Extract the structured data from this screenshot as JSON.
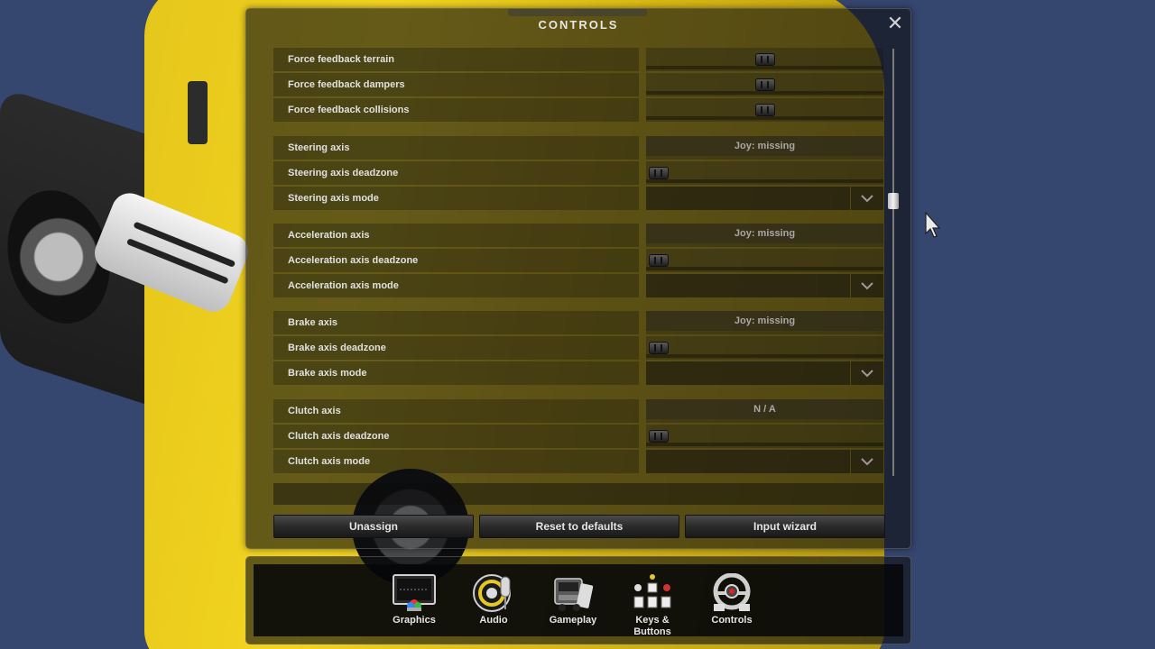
{
  "window": {
    "title": "CONTROLS",
    "close_symbol": "✕"
  },
  "rows": [
    {
      "label": "Force feedback terrain",
      "type": "slider",
      "level": 0.5
    },
    {
      "label": "Force feedback dampers",
      "type": "slider",
      "level": 0.5
    },
    {
      "label": "Force feedback collisions",
      "type": "slider",
      "level": 0.5
    },
    {
      "label": "Steering axis",
      "type": "binding",
      "value": "Joy: missing"
    },
    {
      "label": "Steering axis deadzone",
      "type": "slider",
      "level": 0.0
    },
    {
      "label": "Steering axis mode",
      "type": "dropdown",
      "value": ""
    },
    {
      "label": "Acceleration axis",
      "type": "binding",
      "value": "Joy: missing"
    },
    {
      "label": "Acceleration axis deadzone",
      "type": "slider",
      "level": 0.0
    },
    {
      "label": "Acceleration axis mode",
      "type": "dropdown",
      "value": ""
    },
    {
      "label": "Brake axis",
      "type": "binding",
      "value": "Joy: missing"
    },
    {
      "label": "Brake axis deadzone",
      "type": "slider",
      "level": 0.0
    },
    {
      "label": "Brake axis mode",
      "type": "dropdown",
      "value": ""
    },
    {
      "label": "Clutch axis",
      "type": "binding",
      "value": "N / A"
    },
    {
      "label": "Clutch axis deadzone",
      "type": "slider",
      "level": 0.0
    },
    {
      "label": "Clutch axis mode",
      "type": "dropdown",
      "value": ""
    }
  ],
  "scroll_position": 0.35,
  "buttons": {
    "unassign": "Unassign",
    "reset": "Reset to defaults",
    "wizard": "Input wizard"
  },
  "nav": [
    {
      "label": "Graphics",
      "icon": "monitor-icon"
    },
    {
      "label": "Audio",
      "icon": "microphone-icon"
    },
    {
      "label": "Gameplay",
      "icon": "truck-icon"
    },
    {
      "label": "Keys & Buttons",
      "icon": "keyboard-icon"
    },
    {
      "label": "Controls",
      "icon": "steering-wheel-icon"
    }
  ],
  "colors": {
    "background": "#35466f",
    "truck": "#e5c61b",
    "text": "#e0e0e0",
    "binding_text": "#a8a8a8"
  }
}
